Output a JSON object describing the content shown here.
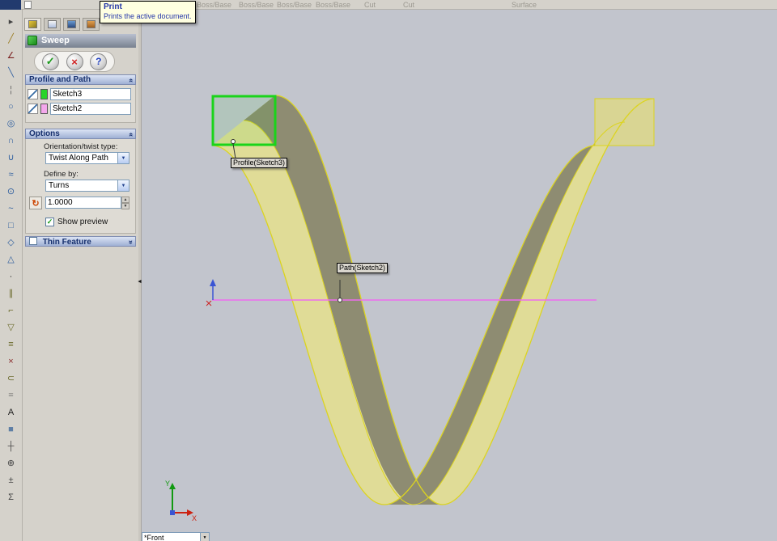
{
  "app": {
    "top_toolbar_labels": [
      "Boss/Base",
      "Boss/Base",
      "Boss/Base",
      "Boss/Base",
      "Cut",
      "Cut",
      "Surface"
    ]
  },
  "tooltip": {
    "title": "Print",
    "body": "Prints the active document."
  },
  "icons": {
    "check": "✓",
    "cross": "×",
    "help": "?",
    "chevron_double": "»",
    "combo_arrow": "▼",
    "spin_up": "▲",
    "spin_down": "▼",
    "checkbox_check": "✓",
    "splitter_arrow": "◄",
    "view_combo_arrow": "▼"
  },
  "left_toolbar": {
    "icons": [
      {
        "name": "select-tool-icon",
        "glyph": "▸",
        "color": "#444444"
      },
      {
        "name": "sketch-tool-icon",
        "glyph": "╱",
        "color": "#9a7b20"
      },
      {
        "name": "dimension-tool-icon",
        "glyph": "∠",
        "color": "#7a1f1f"
      },
      {
        "name": "line-tool-icon",
        "glyph": "╲",
        "color": "#2f5f9f"
      },
      {
        "name": "centerline-tool-icon",
        "glyph": "¦",
        "color": "#666666"
      },
      {
        "name": "circle-tool-icon",
        "glyph": "○",
        "color": "#2f5f9f"
      },
      {
        "name": "perimeter-circle-tool-icon",
        "glyph": "◎",
        "color": "#2f5f9f"
      },
      {
        "name": "centerpoint-arc-tool-icon",
        "glyph": "∩",
        "color": "#2f5f9f"
      },
      {
        "name": "tangent-arc-tool-icon",
        "glyph": "∪",
        "color": "#2f5f9f"
      },
      {
        "name": "three-point-arc-tool-icon",
        "glyph": "≈",
        "color": "#2f5f9f"
      },
      {
        "name": "ellipse-tool-icon",
        "glyph": "⊙",
        "color": "#2f5f9f"
      },
      {
        "name": "spline-tool-icon",
        "glyph": "~",
        "color": "#2f5f9f"
      },
      {
        "name": "rectangle-tool-icon",
        "glyph": "□",
        "color": "#2f5f9f"
      },
      {
        "name": "parallelogram-tool-icon",
        "glyph": "◇",
        "color": "#2f5f9f"
      },
      {
        "name": "polygon-tool-icon",
        "glyph": "△",
        "color": "#2f5f9f"
      },
      {
        "name": "point-tool-icon",
        "glyph": "·",
        "color": "#222222"
      },
      {
        "name": "mirror-tool-icon",
        "glyph": "∥",
        "color": "#6a6a2a"
      },
      {
        "name": "fillet-tool-icon",
        "glyph": "⌐",
        "color": "#6a6a2a"
      },
      {
        "name": "chamfer-tool-icon",
        "glyph": "▽",
        "color": "#6a6a2a"
      },
      {
        "name": "offset-tool-icon",
        "glyph": "≡",
        "color": "#6a6a2a"
      },
      {
        "name": "trim-tool-icon",
        "glyph": "×",
        "color": "#8a2a2a"
      },
      {
        "name": "convert-entities-tool-icon",
        "glyph": "⊂",
        "color": "#6a6a2a"
      },
      {
        "name": "construction-geometry-tool-icon",
        "glyph": "=",
        "color": "#666666"
      },
      {
        "name": "text-tool-icon",
        "glyph": "A",
        "color": "#222222"
      },
      {
        "name": "plane-tool-icon",
        "glyph": "■",
        "color": "#5f7fa5"
      },
      {
        "name": "axis-tool-icon",
        "glyph": "┼",
        "color": "#444444"
      },
      {
        "name": "coordinate-system-tool-icon",
        "glyph": "⊕",
        "color": "#444444"
      },
      {
        "name": "measure-tool-icon",
        "glyph": "±",
        "color": "#444444"
      },
      {
        "name": "equation-tool-icon",
        "glyph": "Σ",
        "color": "#444444"
      }
    ]
  },
  "property_manager": {
    "title": "Sweep",
    "groups": {
      "profile_and_path": {
        "title": "Profile and Path",
        "profile_value": "Sketch3",
        "path_value": "Sketch2"
      },
      "options": {
        "title": "Options",
        "orientation_label": "Orientation/twist type:",
        "orientation_value": "Twist Along Path",
        "define_by_label": "Define by:",
        "define_by_value": "Turns",
        "turns_value": "1.0000",
        "show_preview_label": "Show preview"
      },
      "thin_feature": {
        "title": "Thin Feature"
      }
    }
  },
  "viewport": {
    "profile_label": "Profile(Sketch3)",
    "path_label": "Path(Sketch2)",
    "view_selector": "*Front",
    "triad": {
      "x": "X",
      "y": "Y"
    },
    "colors": {
      "background": "#c2c5cd",
      "ribbon_light": "#e0dc97",
      "ribbon_dark": "#8e8c72",
      "ribbon_cap": "#d9d593",
      "curve": "#dcd41f",
      "path_line": "#ee6cee",
      "profile_box": "#1ad41a"
    }
  }
}
